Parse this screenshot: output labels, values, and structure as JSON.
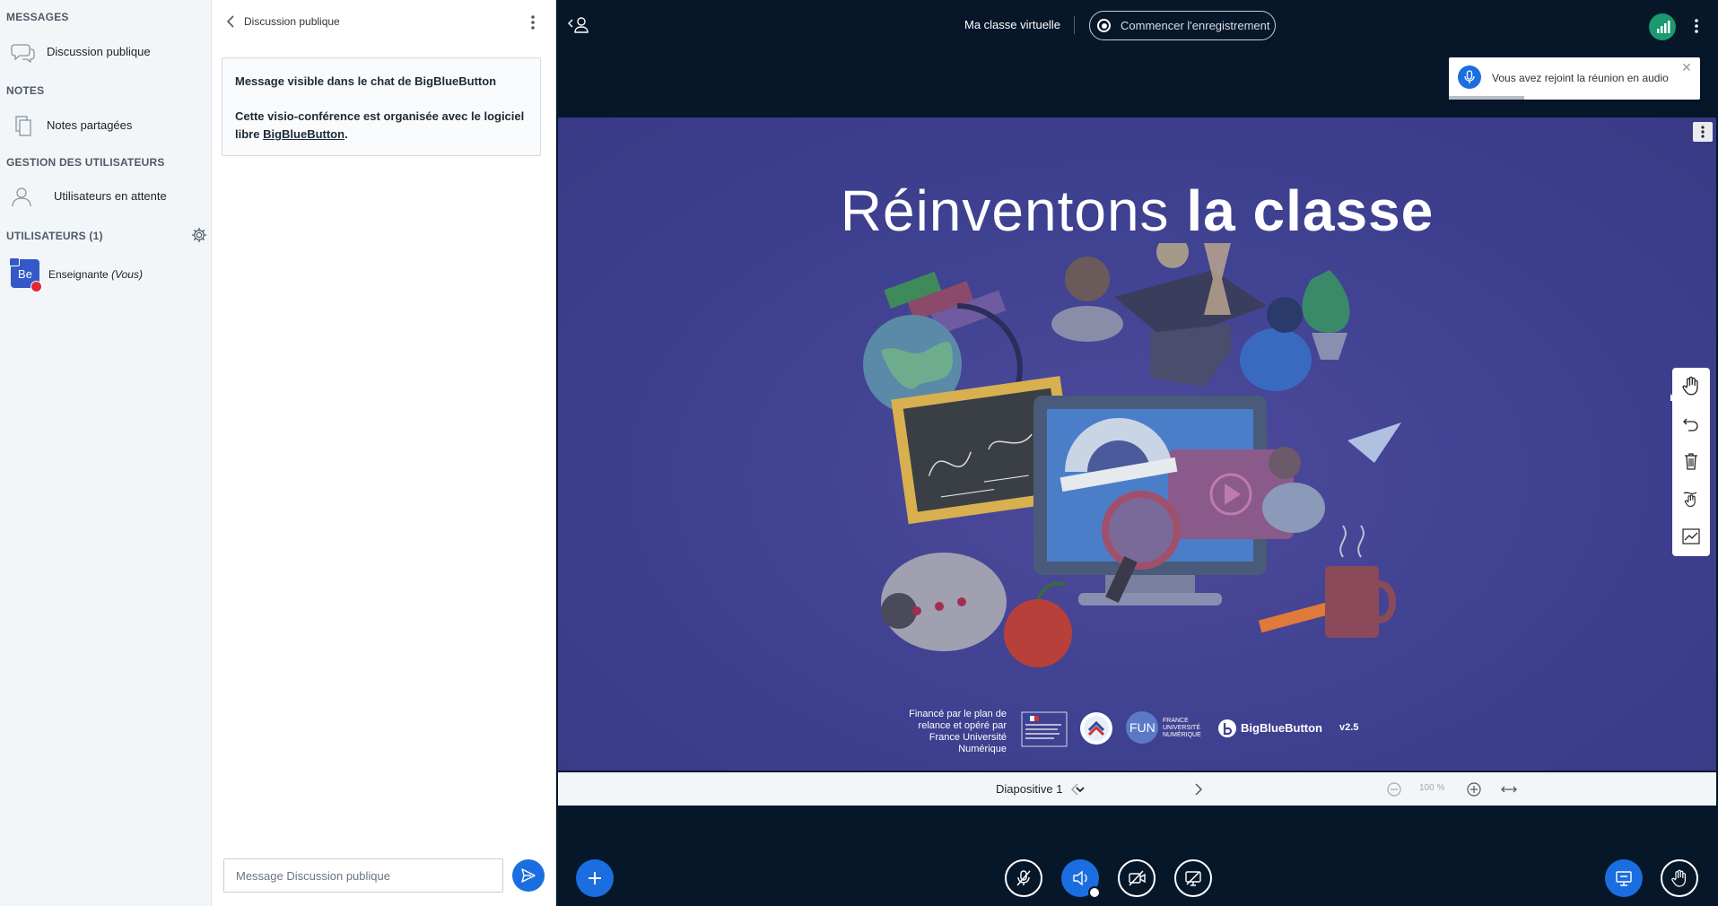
{
  "sidebar": {
    "messages_title": "MESSAGES",
    "public_chat": "Discussion publique",
    "notes_title": "NOTES",
    "shared_notes": "Notes partagées",
    "user_mgmt_title": "GESTION DES UTILISATEURS",
    "waiting_users": "Utilisateurs en attente",
    "users_title": "UTILISATEURS (1)",
    "user": {
      "initials": "Be",
      "name": "Enseignante",
      "suffix": "(Vous)"
    }
  },
  "chat": {
    "header_title": "Discussion publique",
    "welcome_line1": "Message visible dans le chat de BigBlueButton",
    "welcome_line2_start": "Cette visio-conférence est organisée avec le logiciel libre ",
    "welcome_link": "BigBlueButton",
    "welcome_line2_end": ".",
    "input_placeholder": "Message Discussion publique"
  },
  "header": {
    "meeting_title": "Ma classe virtuelle",
    "record_label": "Commencer l'enregistrement"
  },
  "toast": {
    "message": "Vous avez rejoint la réunion en audio"
  },
  "slide": {
    "title_light": "Réinventons ",
    "title_bold": "la classe",
    "footer_text": "Financé par le plan de relance et opéré par France Université Numérique",
    "logo_fun": "FUN",
    "logo_fun_text": "FRANCE UNIVERSITÉ NUMÉRIQUE",
    "logo_bbb": "BigBlueButton",
    "version": "v2.5"
  },
  "slide_nav": {
    "current": "Diapositive 1",
    "zoom": "100 %"
  },
  "colors": {
    "accent": "#1b6ee0",
    "dark_bg": "#06172a",
    "connection": "#1a9a6e",
    "mute_badge": "#e0282f"
  }
}
